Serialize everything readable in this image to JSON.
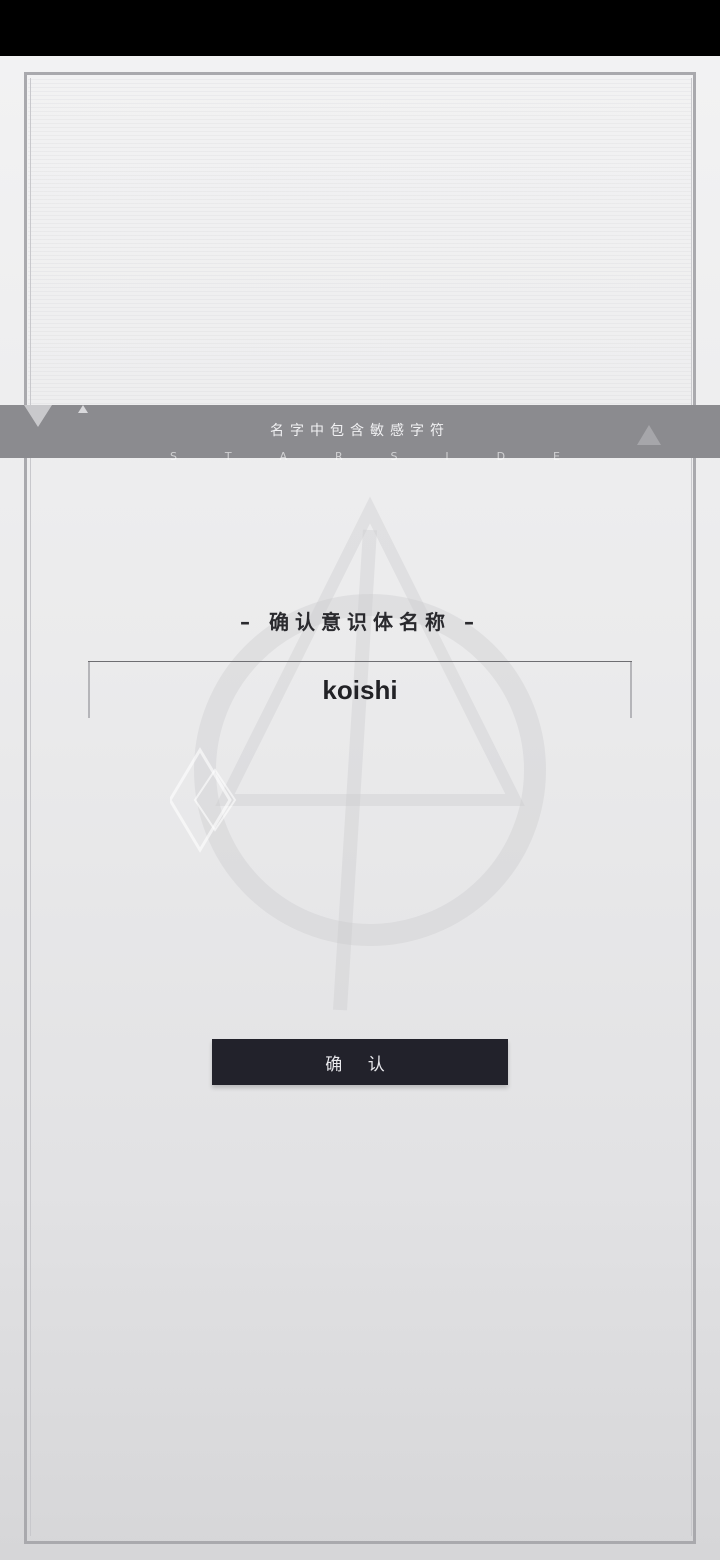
{
  "banner": {
    "message": "名字中包含敏感字符",
    "sub_letters": [
      "S",
      "T",
      "A",
      "R",
      "S",
      "I",
      "D",
      "E"
    ]
  },
  "dialog": {
    "title": "– 确认意识体名称 –",
    "name_value": "koishi",
    "confirm_label": "确 认"
  },
  "colors": {
    "banner": "#8b8b8f",
    "button": "#22222b",
    "frame": "#a9a9ad"
  }
}
